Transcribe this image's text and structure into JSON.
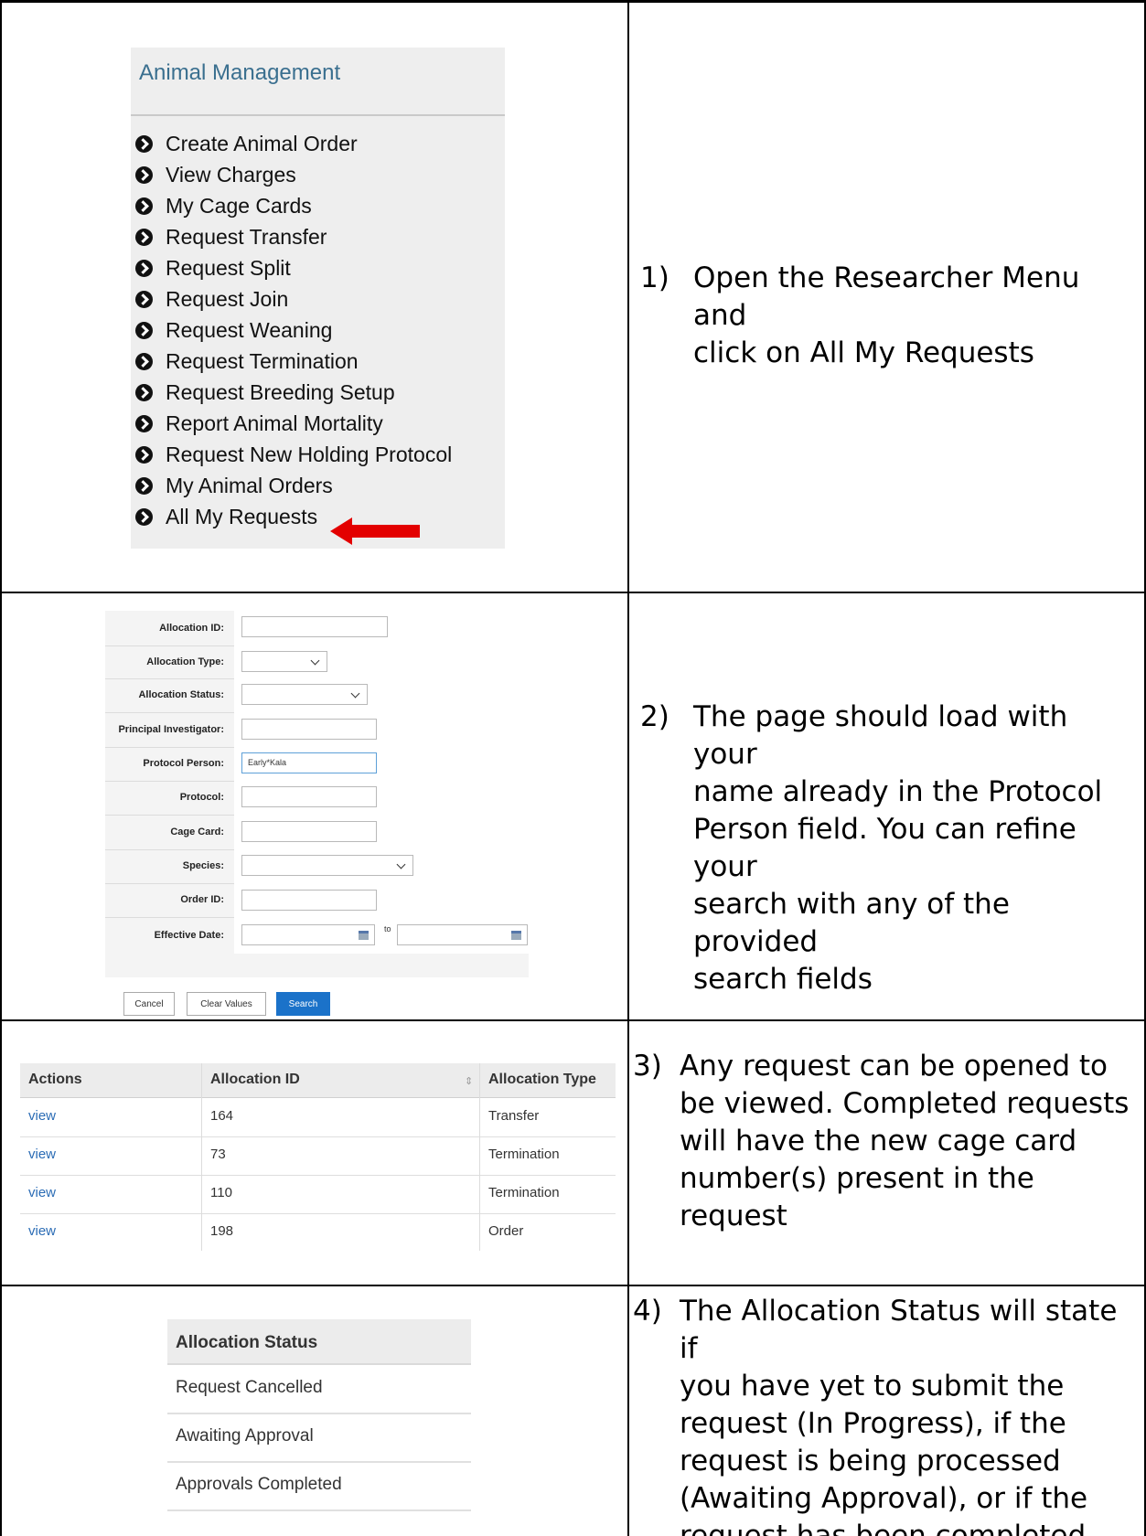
{
  "panel1": {
    "menu_title": "Animal Management",
    "items": [
      "Create Animal Order",
      "View Charges",
      "My Cage Cards",
      "Request Transfer",
      "Request Split",
      "Request Join",
      "Request Weaning",
      "Request Termination",
      "Request Breeding Setup",
      "Report Animal Mortality",
      "Request New Holding Protocol",
      "My Animal Orders",
      "All My Requests"
    ],
    "arrow_color": "#e30000",
    "step_number": "1)",
    "step_text": "Open the Researcher Menu and\nclick on All My Requests"
  },
  "panel2": {
    "labels": {
      "allocation_id": "Allocation ID:",
      "allocation_type": "Allocation Type:",
      "allocation_status": "Allocation Status:",
      "principal_investigator": "Principal Investigator:",
      "protocol_person": "Protocol Person:",
      "protocol": "Protocol:",
      "cage_card": "Cage Card:",
      "species": "Species:",
      "order_id": "Order ID:",
      "effective_date": "Effective Date:"
    },
    "protocol_person_value": "Early*Kala",
    "to_text": "to",
    "buttons": {
      "cancel": "Cancel",
      "clear": "Clear Values",
      "search": "Search"
    },
    "step_number": "2)",
    "step_text": "The page should load with your\nname already in the Protocol\nPerson field. You can refine your\nsearch with any of the provided\nsearch fields"
  },
  "panel3": {
    "headers": [
      "Actions",
      "Allocation ID",
      "Allocation Type"
    ],
    "rows": [
      {
        "action": "view",
        "id": "164",
        "type": "Transfer"
      },
      {
        "action": "view",
        "id": "73",
        "type": "Termination"
      },
      {
        "action": "view",
        "id": "110",
        "type": "Termination"
      },
      {
        "action": "view",
        "id": "198",
        "type": "Order"
      }
    ],
    "step_number": "3)",
    "step_text": "Any request can be opened to\nbe viewed. Completed requests\nwill have the new cage card\nnumber(s) present in the\nrequest"
  },
  "panel4": {
    "header": "Allocation Status",
    "rows": [
      "Request Cancelled",
      "Awaiting Approval",
      "Approvals Completed"
    ],
    "step_number": "4)",
    "step_text": "The Allocation Status will state if\nyou have yet to submit the\nrequest (In Progress), if the\nrequest is being processed\n(Awaiting Approval), or if the\nrequest has been completed"
  }
}
